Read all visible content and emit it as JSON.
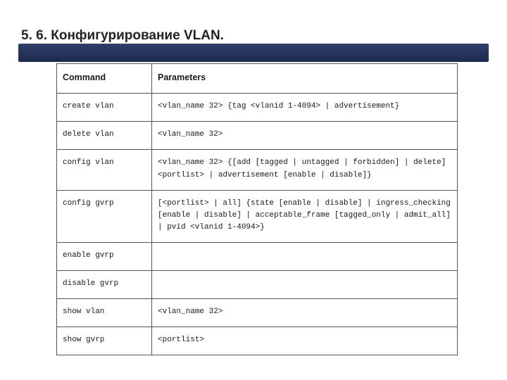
{
  "heading": "5. 6. Конфигурирование VLAN.",
  "table": {
    "headers": {
      "command": "Command",
      "parameters": "Parameters"
    },
    "rows": [
      {
        "command": "create vlan",
        "parameters": "<vlan_name 32> {tag <vlanid 1-4094>  | advertisement}"
      },
      {
        "command": "delete vlan",
        "parameters": "<vlan_name 32>"
      },
      {
        "command": "config vlan",
        "parameters": "<vlan_name 32> {[add [tagged | untagged | forbidden] | delete] <portlist> | advertisement [enable | disable]}"
      },
      {
        "command": "config gvrp",
        "parameters": "[<portlist> | all] {state [enable | disable] | ingress_checking [enable | disable] | acceptable_frame [tagged_only | admit_all] | pvid <vlanid 1-4094>}"
      },
      {
        "command": "enable gvrp",
        "parameters": ""
      },
      {
        "command": "disable gvrp",
        "parameters": ""
      },
      {
        "command": "show vlan",
        "parameters": "<vlan_name 32>"
      },
      {
        "command": "show gvrp",
        "parameters": "<portlist>"
      }
    ]
  }
}
